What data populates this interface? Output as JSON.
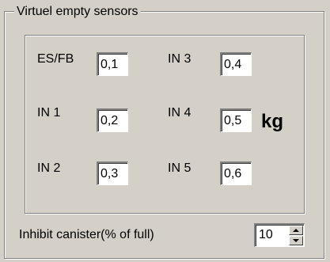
{
  "group": {
    "title": "Virtuel empty sensors"
  },
  "sensors": [
    {
      "label": "ES/FB",
      "value": "0,1"
    },
    {
      "label": "IN 1",
      "value": "0,2"
    },
    {
      "label": "IN 2",
      "value": "0,3"
    },
    {
      "label": "IN 3",
      "value": "0,4"
    },
    {
      "label": "IN 4",
      "value": "0,5"
    },
    {
      "label": "IN 5",
      "value": "0,6"
    }
  ],
  "unit": "kg",
  "inhibit": {
    "label": "Inhibit canister(% of full)",
    "value": "10"
  },
  "colors": {
    "background": "#d4d0c8",
    "field": "#ffffff",
    "border_dark": "#808080",
    "border_light": "#ffffff"
  },
  "icons": {
    "spin_up": "arrow-up-icon",
    "spin_down": "arrow-down-icon"
  }
}
